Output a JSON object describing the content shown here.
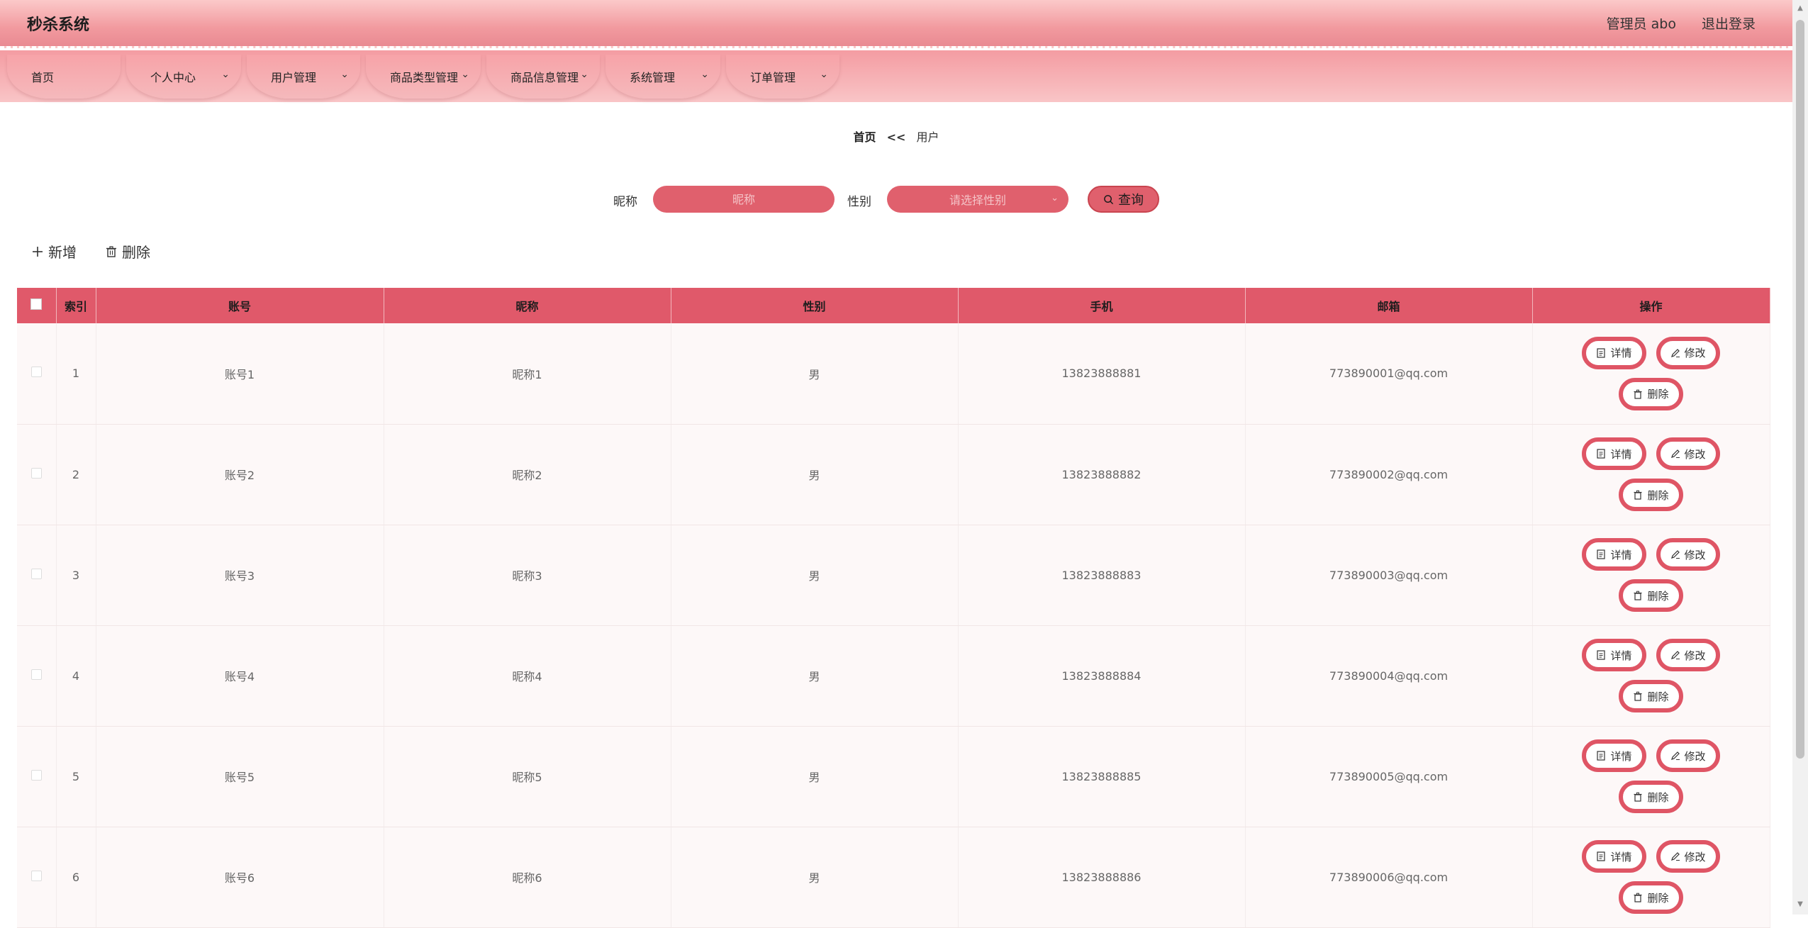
{
  "app": {
    "title": "秒杀系统"
  },
  "header": {
    "user_label": "管理员 abo",
    "logout": "退出登录"
  },
  "nav": [
    {
      "label": "首页",
      "has_dropdown": false
    },
    {
      "label": "个人中心",
      "has_dropdown": true
    },
    {
      "label": "用户管理",
      "has_dropdown": true
    },
    {
      "label": "商品类型管理",
      "has_dropdown": true
    },
    {
      "label": "商品信息管理",
      "has_dropdown": true
    },
    {
      "label": "系统管理",
      "has_dropdown": true
    },
    {
      "label": "订单管理",
      "has_dropdown": true
    }
  ],
  "breadcrumb": {
    "home": "首页",
    "separator": "<<",
    "current": "用户"
  },
  "search": {
    "nickname_label": "昵称",
    "nickname_placeholder": "昵称",
    "gender_label": "性别",
    "gender_placeholder": "请选择性别",
    "query_button": "查询"
  },
  "actions": {
    "add": "新增",
    "delete": "删除"
  },
  "table": {
    "headers": {
      "index": "索引",
      "account": "账号",
      "nickname": "昵称",
      "gender": "性别",
      "phone": "手机",
      "email": "邮箱",
      "ops": "操作"
    },
    "op_labels": {
      "detail": "详情",
      "edit": "修改",
      "delete": "删除"
    },
    "rows": [
      {
        "index": "1",
        "account": "账号1",
        "nickname": "昵称1",
        "gender": "男",
        "phone": "13823888881",
        "email": "773890001@qq.com"
      },
      {
        "index": "2",
        "account": "账号2",
        "nickname": "昵称2",
        "gender": "男",
        "phone": "13823888882",
        "email": "773890002@qq.com"
      },
      {
        "index": "3",
        "account": "账号3",
        "nickname": "昵称3",
        "gender": "男",
        "phone": "13823888883",
        "email": "773890003@qq.com"
      },
      {
        "index": "4",
        "account": "账号4",
        "nickname": "昵称4",
        "gender": "男",
        "phone": "13823888884",
        "email": "773890004@qq.com"
      },
      {
        "index": "5",
        "account": "账号5",
        "nickname": "昵称5",
        "gender": "男",
        "phone": "13823888885",
        "email": "773890005@qq.com"
      },
      {
        "index": "6",
        "account": "账号6",
        "nickname": "昵称6",
        "gender": "男",
        "phone": "13823888886",
        "email": "773890006@qq.com"
      }
    ]
  },
  "colors": {
    "accent": "#e0596a",
    "nav_bg": "#f49ca2",
    "header_bg": "#f29a9f"
  },
  "icons": {
    "add": "plus-icon",
    "delete": "trash-icon",
    "search": "search-icon",
    "detail": "document-icon",
    "edit": "pencil-icon",
    "chevron": "chevron-down-icon"
  }
}
